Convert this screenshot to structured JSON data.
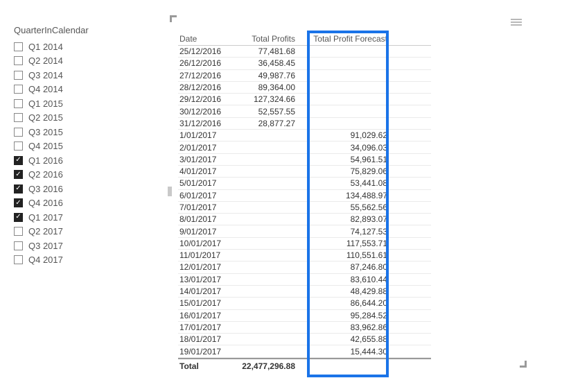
{
  "slicer": {
    "title": "QuarterInCalendar",
    "items": [
      {
        "label": "Q1 2014",
        "checked": false
      },
      {
        "label": "Q2 2014",
        "checked": false
      },
      {
        "label": "Q3 2014",
        "checked": false
      },
      {
        "label": "Q4 2014",
        "checked": false
      },
      {
        "label": "Q1 2015",
        "checked": false
      },
      {
        "label": "Q2 2015",
        "checked": false
      },
      {
        "label": "Q3 2015",
        "checked": false
      },
      {
        "label": "Q4 2015",
        "checked": false
      },
      {
        "label": "Q1 2016",
        "checked": true
      },
      {
        "label": "Q2 2016",
        "checked": true
      },
      {
        "label": "Q3 2016",
        "checked": true
      },
      {
        "label": "Q4 2016",
        "checked": true
      },
      {
        "label": "Q1 2017",
        "checked": true
      },
      {
        "label": "Q2 2017",
        "checked": false
      },
      {
        "label": "Q3 2017",
        "checked": false
      },
      {
        "label": "Q4 2017",
        "checked": false
      }
    ]
  },
  "table": {
    "headers": {
      "date": "Date",
      "total_profits": "Total Profits",
      "forecast": "Total Profit Forecast"
    },
    "rows": [
      {
        "date": "25/12/2016",
        "total_profits": "77,481.68",
        "forecast": ""
      },
      {
        "date": "26/12/2016",
        "total_profits": "36,458.45",
        "forecast": ""
      },
      {
        "date": "27/12/2016",
        "total_profits": "49,987.76",
        "forecast": ""
      },
      {
        "date": "28/12/2016",
        "total_profits": "89,364.00",
        "forecast": ""
      },
      {
        "date": "29/12/2016",
        "total_profits": "127,324.66",
        "forecast": ""
      },
      {
        "date": "30/12/2016",
        "total_profits": "52,557.55",
        "forecast": ""
      },
      {
        "date": "31/12/2016",
        "total_profits": "28,877.27",
        "forecast": ""
      },
      {
        "date": "1/01/2017",
        "total_profits": "",
        "forecast": "91,029.62"
      },
      {
        "date": "2/01/2017",
        "total_profits": "",
        "forecast": "34,096.03"
      },
      {
        "date": "3/01/2017",
        "total_profits": "",
        "forecast": "54,961.51"
      },
      {
        "date": "4/01/2017",
        "total_profits": "",
        "forecast": "75,829.06"
      },
      {
        "date": "5/01/2017",
        "total_profits": "",
        "forecast": "53,441.08"
      },
      {
        "date": "6/01/2017",
        "total_profits": "",
        "forecast": "134,488.97"
      },
      {
        "date": "7/01/2017",
        "total_profits": "",
        "forecast": "55,562.56"
      },
      {
        "date": "8/01/2017",
        "total_profits": "",
        "forecast": "82,893.07"
      },
      {
        "date": "9/01/2017",
        "total_profits": "",
        "forecast": "74,127.53"
      },
      {
        "date": "10/01/2017",
        "total_profits": "",
        "forecast": "117,553.71"
      },
      {
        "date": "11/01/2017",
        "total_profits": "",
        "forecast": "110,551.61"
      },
      {
        "date": "12/01/2017",
        "total_profits": "",
        "forecast": "87,246.80"
      },
      {
        "date": "13/01/2017",
        "total_profits": "",
        "forecast": "83,610.44"
      },
      {
        "date": "14/01/2017",
        "total_profits": "",
        "forecast": "48,429.88"
      },
      {
        "date": "15/01/2017",
        "total_profits": "",
        "forecast": "86,644.20"
      },
      {
        "date": "16/01/2017",
        "total_profits": "",
        "forecast": "95,284.52"
      },
      {
        "date": "17/01/2017",
        "total_profits": "",
        "forecast": "83,962.86"
      },
      {
        "date": "18/01/2017",
        "total_profits": "",
        "forecast": "42,655.88"
      },
      {
        "date": "19/01/2017",
        "total_profits": "",
        "forecast": "15,444.30"
      }
    ],
    "footer": {
      "label": "Total",
      "total_profits": "22,477,296.88",
      "forecast": ""
    }
  },
  "highlight_color": "#1a73e8"
}
